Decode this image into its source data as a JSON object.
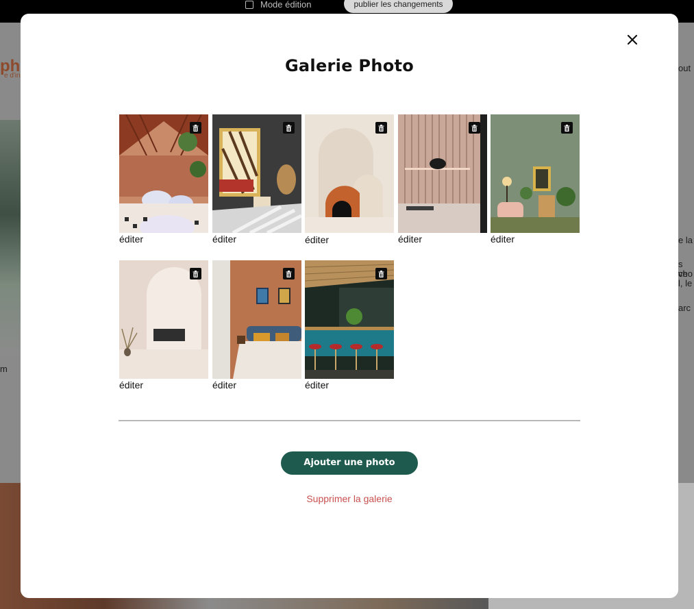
{
  "topbar": {
    "mode_label": "Mode édition",
    "publish_label": "publier les changements"
  },
  "background": {
    "logo_text": "ph",
    "logo_sub": "e d'in",
    "edit_left": "m",
    "right_snippets": [
      "out",
      "e la",
      "s ve",
      "cho",
      "l, le",
      "arc"
    ]
  },
  "modal": {
    "title": "Galerie Photo",
    "photos": [
      {
        "edit_label": "éditer",
        "subject": "restaurant-greenhouse"
      },
      {
        "edit_label": "éditer",
        "subject": "hanging-chair-lounge"
      },
      {
        "edit_label": "éditer",
        "subject": "arch-still-life"
      },
      {
        "edit_label": "éditer",
        "subject": "kitchen-lamp"
      },
      {
        "edit_label": "éditer",
        "subject": "green-living-room"
      },
      {
        "edit_label": "éditer",
        "subject": "white-arch-room"
      },
      {
        "edit_label": "éditer",
        "subject": "terracotta-bedroom"
      },
      {
        "edit_label": "éditer",
        "subject": "teal-bar"
      }
    ],
    "add_button_label": "Ajouter une photo",
    "delete_gallery_label": "Supprimer la galerie"
  },
  "colors": {
    "primary_button": "#1f5a4e",
    "danger_text": "#c94f4f",
    "overlay": "#8a8a8a"
  }
}
